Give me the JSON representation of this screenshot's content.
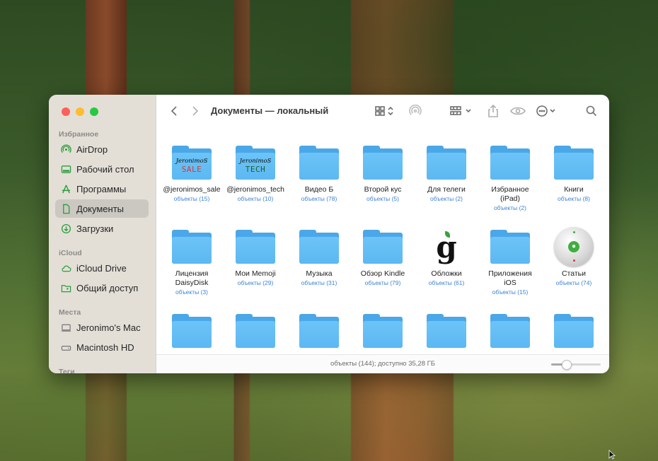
{
  "window": {
    "title": "Документы — локальный",
    "status": "объекты (144); доступно 35,28 ГБ",
    "icon_size_fraction": 0.3
  },
  "sidebar": {
    "sections": {
      "favorites": "Избранное",
      "icloud": "iCloud",
      "locations": "Места",
      "tags": "Теги"
    },
    "items": [
      {
        "label": "AirDrop",
        "icon": "airdrop-icon"
      },
      {
        "label": "Рабочий стол",
        "icon": "desktop-icon"
      },
      {
        "label": "Программы",
        "icon": "applications-icon"
      },
      {
        "label": "Документы",
        "icon": "document-icon",
        "active": true
      },
      {
        "label": "Загрузки",
        "icon": "downloads-icon"
      },
      {
        "label": "iCloud Drive",
        "icon": "cloud-icon"
      },
      {
        "label": "Общий доступ",
        "icon": "shared-folder-icon"
      },
      {
        "label": "Jeronimo's Mac",
        "icon": "computer-icon"
      },
      {
        "label": "Macintosh HD",
        "icon": "disk-icon"
      }
    ]
  },
  "files": [
    {
      "name": "@jeronimos_sale",
      "count": "объекты (15)",
      "art_title": "JeronimoS",
      "art_sub": "SALE"
    },
    {
      "name": "@jeronimos_tech",
      "count": "объекты (10)",
      "art_title": "JeronimoS",
      "art_sub": "TECH"
    },
    {
      "name": "Видео Б",
      "count": "объекты (78)"
    },
    {
      "name": "Второй кус",
      "count": "объекты (5)"
    },
    {
      "name": "Для телеги",
      "count": "объекты (2)"
    },
    {
      "name": "Избранное (iPad)",
      "count": "объекты (2)"
    },
    {
      "name": "Книги",
      "count": "объекты (8)"
    },
    {
      "name": "Лицензия DaisyDisk",
      "count": "объекты (3)"
    },
    {
      "name": "Мои Memoji",
      "count": "объекты (29)"
    },
    {
      "name": "Музыка",
      "count": "объекты (31)"
    },
    {
      "name": "Обзор Kindle",
      "count": "объекты (79)"
    },
    {
      "name": "Обложки",
      "count": "объекты (61)",
      "glyph": "g"
    },
    {
      "name": "Приложения iOS",
      "count": "объекты (15)"
    },
    {
      "name": "Статьи",
      "count": "объекты (74)"
    }
  ],
  "colors": {
    "folder": "#5cb8f2",
    "accent_link": "#3b82d6",
    "sidebar_icon": "#2a9d3a"
  }
}
